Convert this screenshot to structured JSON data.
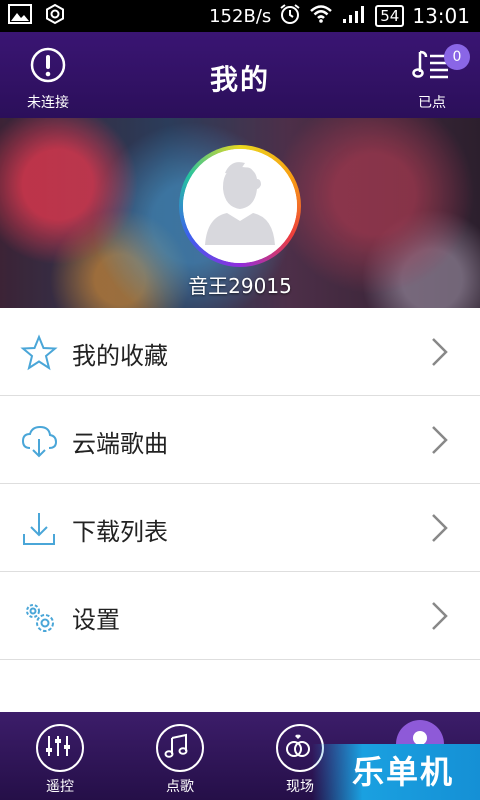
{
  "status_bar": {
    "network_speed": "152B/s",
    "battery": "54",
    "time": "13:01"
  },
  "header": {
    "title": "我的",
    "left_label": "未连接",
    "right_label": "已点",
    "badge_count": "0"
  },
  "profile": {
    "username": "音王29015"
  },
  "menu": [
    {
      "label": "我的收藏",
      "icon": "star-icon"
    },
    {
      "label": "云端歌曲",
      "icon": "cloud-download-icon"
    },
    {
      "label": "下载列表",
      "icon": "download-icon"
    },
    {
      "label": "设置",
      "icon": "gear-icon"
    }
  ],
  "bottom_nav": [
    {
      "label": "遥控",
      "icon": "equalizer-icon"
    },
    {
      "label": "点歌",
      "icon": "music-note-icon"
    },
    {
      "label": "现场",
      "icon": "rings-icon"
    }
  ],
  "watermark": "乐单机",
  "colors": {
    "header_bg": "#2b0f5a",
    "accent": "#8a66e6",
    "icon_blue": "#4aa6d8"
  }
}
